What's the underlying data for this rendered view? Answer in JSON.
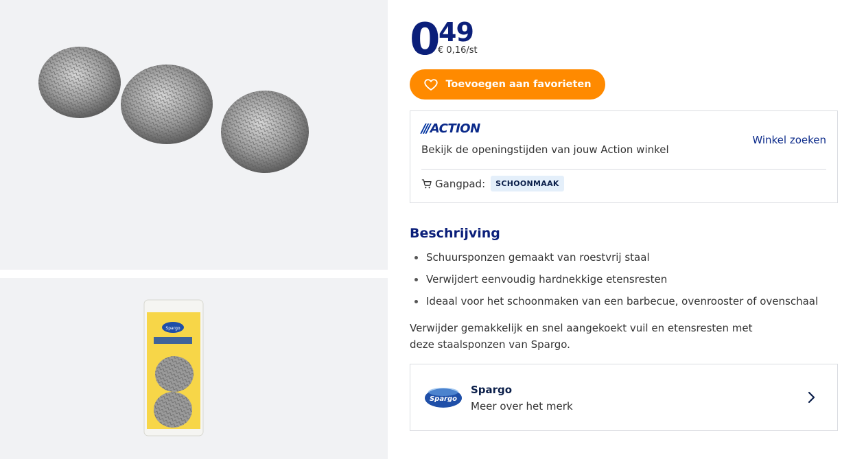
{
  "gallery": {
    "image_top_alt": "3 stalen schuursponzen",
    "image_bottom_alt": "Spargo verpakking"
  },
  "price": {
    "integer": "0",
    "decimal": "49",
    "unit_price": "€ 0,16/st"
  },
  "favorite_button": {
    "label": "Toevoegen aan favorieten",
    "icon": "heart-icon",
    "color": "#ff8a00"
  },
  "store": {
    "logo_bars": "///",
    "logo_text": "ACTION",
    "text": "Bekijk de openingstijden van jouw Action winkel",
    "link_label": "Winkel zoeken",
    "aisle_label": "Gangpad:",
    "aisle_icon": "cart-icon",
    "aisle_value": "SCHOONMAAK"
  },
  "description": {
    "title": "Beschrijving",
    "bullets": [
      "Schuursponzen gemaakt van roestvrij staal",
      "Verwijdert eenvoudig hardnekkige etensresten",
      "Ideaal voor het schoonmaken van een barbecue, ovenrooster of ovenschaal"
    ],
    "paragraph": "Verwijder gemakkelijk en snel aangekoekt vuil en etensresten met deze staalsponzen van Spargo."
  },
  "brand": {
    "logo_text": "Spargo",
    "name": "Spargo",
    "sub": "Meer over het merk",
    "icon": "chevron-right-icon"
  },
  "colors": {
    "brand_blue": "#0b1f7a",
    "accent_orange": "#ff8a00",
    "badge_bg": "#e4effa"
  }
}
